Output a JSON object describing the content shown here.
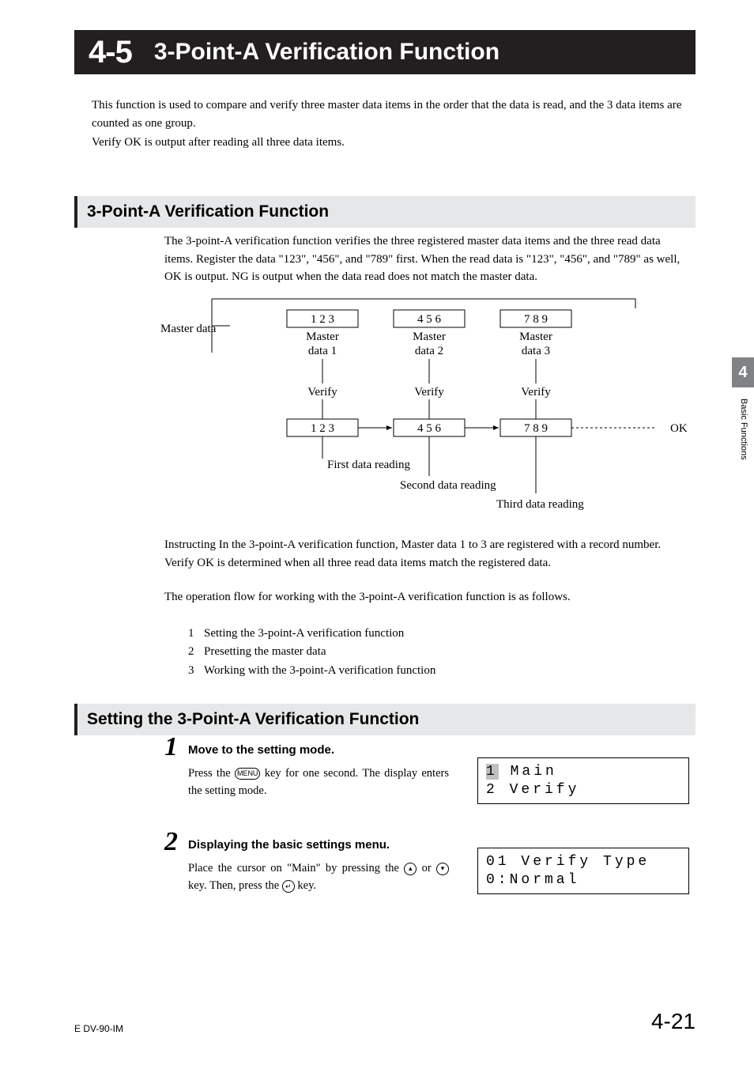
{
  "header": {
    "num": "4-5",
    "title": "3-Point-A Verification Function"
  },
  "intro": {
    "p1": "This function is used to compare and verify three master data items in the order that the data is read, and the 3 data items are counted as one group.",
    "p2": "Verify OK is output after reading all three data items."
  },
  "sub1": "3-Point-A Verification Function",
  "txtA": "The 3-point-A verification function verifies the three registered master data items and the three read data items. Register the data \"123\", \"456\", and \"789\" first. When the read data is \"123\", \"456\", and \"789\" as well, OK is output. NG is output when the data read does not match the master data.",
  "diagram": {
    "master": "Master data",
    "m1": "Master data 1",
    "m2": "Master data 2",
    "m3": "Master data 3",
    "d123": "1   2   3",
    "d456": "4   5   6",
    "d789": "7   8   9",
    "verify": "Verify",
    "first": "First data reading",
    "second": "Second data reading",
    "third": "Third data reading",
    "ok": "OK"
  },
  "txtB": "Instructing In the 3-point-A verification function, Master data 1 to 3 are registered with a record number. Verify OK is determined when all three read data items match the registered data.",
  "txtC": "The operation flow for working with the 3-point-A verification function is as follows.",
  "list": {
    "n1": "1",
    "i1": "Setting the 3-point-A verification function",
    "n2": "2",
    "i2": "Presetting the master data",
    "n3": "3",
    "i3": "Working with the 3-point-A verification function"
  },
  "sub2": "Setting the 3-Point-A Verification Function",
  "step1": {
    "num": "1",
    "title": "Move to the setting mode.",
    "pre": "Press the ",
    "menu": "MENU",
    "post": " key for one second. The display enters the setting mode."
  },
  "step2": {
    "num": "2",
    "title": "Displaying the basic settings menu.",
    "pre": "Place the cursor on \"Main\" by pressing the ",
    "mid": " or ",
    "post1": " key. Then, press the ",
    "post2": " key.",
    "up": "▴",
    "down": "▾",
    "enter": "↵"
  },
  "lcd1": {
    "cur": "1",
    "rest1": " Main",
    "line2": "2 Verify"
  },
  "lcd2": {
    "line1": "01 Verify Type",
    "line2": "0:Normal"
  },
  "side": {
    "chap": "4",
    "label": "Basic Functions"
  },
  "footer": {
    "docid": "E DV-90-IM",
    "page": "4-21"
  }
}
